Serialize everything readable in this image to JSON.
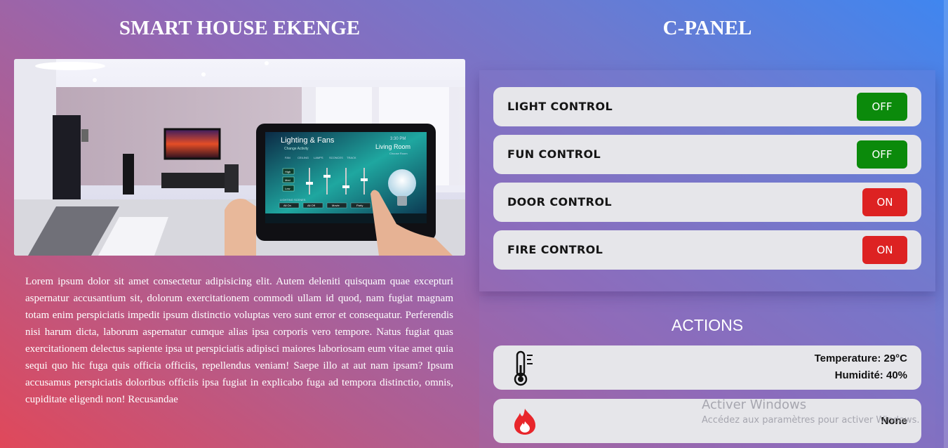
{
  "left": {
    "title": "SMART HOUSE EKENGE",
    "image_alt": "Smart home living room with tablet control",
    "tablet": {
      "heading": "Lighting & Fans",
      "subheading": "Change Activity",
      "time": "3:30 PM",
      "room": "Living Room",
      "room_sub": "Choose Room",
      "columns": [
        "FAN",
        "CEILING",
        "LAMPS",
        "SCONCES",
        "TRACK"
      ],
      "fan_levels": [
        "High",
        "Med",
        "Low"
      ],
      "scene_label": "LIGHTING SCENES",
      "scenes": [
        "All On",
        "All Off",
        "Movie",
        "Party"
      ]
    },
    "paragraph": "Lorem ipsum dolor sit amet consectetur adipisicing elit. Autem deleniti quisquam quae excepturi aspernatur accusantium sit, dolorum exercitationem commodi ullam id quod, nam fugiat magnam totam enim perspiciatis impedit ipsum distinctio voluptas vero sunt error et consequatur. Perferendis nisi harum dicta, laborum aspernatur cumque alias ipsa corporis vero tempore. Natus fugiat quas exercitationem delectus sapiente ipsa ut perspiciatis adipisci maiores laboriosam eum vitae amet quia sequi quo hic fuga quis officia officiis, repellendus veniam! Saepe illo at aut nam ipsam? Ipsum accusamus perspiciatis doloribus officiis ipsa fugiat in explicabo fuga ad tempora distinctio, omnis, cupiditate eligendi non! Recusandae"
  },
  "right": {
    "title": "C-PANEL",
    "controls": [
      {
        "label": "LIGHT CONTROL",
        "state": "OFF"
      },
      {
        "label": "FUN CONTROL",
        "state": "OFF"
      },
      {
        "label": "DOOR CONTROL",
        "state": "ON"
      },
      {
        "label": "FIRE CONTROL",
        "state": "ON"
      }
    ],
    "actions_title": "ACTIONS",
    "temperature": "Temperature: 29°C",
    "humidity": "Humidité: 40%",
    "fire_status": "None"
  },
  "watermark": {
    "title": "Activer Windows",
    "subtitle": "Accédez aux paramètres pour activer Windows."
  },
  "colors": {
    "off_button": "#0b8a0b",
    "on_button": "#dd2222",
    "row_bg": "#e6e6ea",
    "fire_icon": "#e8262b"
  },
  "icons": {
    "temperature": "thermometer-icon",
    "fire": "fire-icon"
  }
}
